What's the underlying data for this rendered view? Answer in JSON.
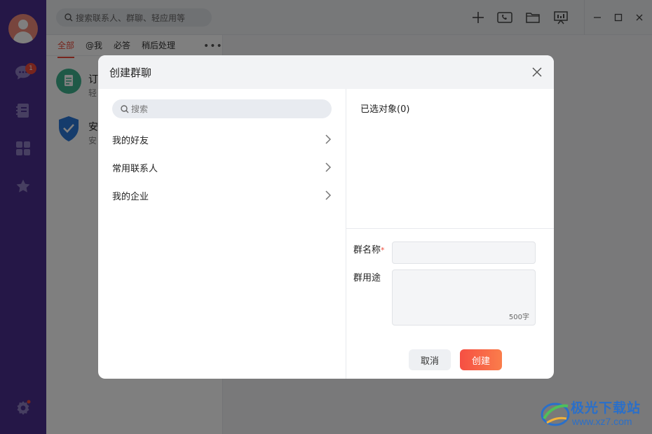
{
  "sidebar": {
    "badge_count": "1",
    "icons": [
      "avatar",
      "chat-icon",
      "contacts-icon",
      "apps-icon",
      "favorites-icon",
      "settings-icon"
    ]
  },
  "topbar": {
    "search_placeholder": "搜索联系人、群聊、轻应用等"
  },
  "conversation_list": {
    "tabs": [
      {
        "label": "全部",
        "active": true
      },
      {
        "label": "@我",
        "active": false
      },
      {
        "label": "必答",
        "active": false
      },
      {
        "label": "稍后处理",
        "active": false
      }
    ],
    "more_label": "•••",
    "items": [
      {
        "title": "订",
        "subtitle": "轻"
      },
      {
        "title": "安",
        "subtitle": "安"
      }
    ]
  },
  "dialog": {
    "title": "创建群聊",
    "search_placeholder": "搜索",
    "categories": [
      {
        "label": "我的好友"
      },
      {
        "label": "常用联系人"
      },
      {
        "label": "我的企业"
      }
    ],
    "selected_label": "已选对象(0)",
    "group_name_label": "群名称",
    "required_mark": "*",
    "group_purpose_label": "群用途",
    "char_limit": "500字",
    "cancel_label": "取消",
    "create_label": "创建"
  },
  "watermark": {
    "name": "极光下载站",
    "url": "www.xz7.com"
  },
  "colors": {
    "sidebar_bg": "#4b2f8e",
    "accent": "#ee4b3a",
    "create_gradient_start": "#f64f43",
    "create_gradient_end": "#fa7d4b"
  }
}
